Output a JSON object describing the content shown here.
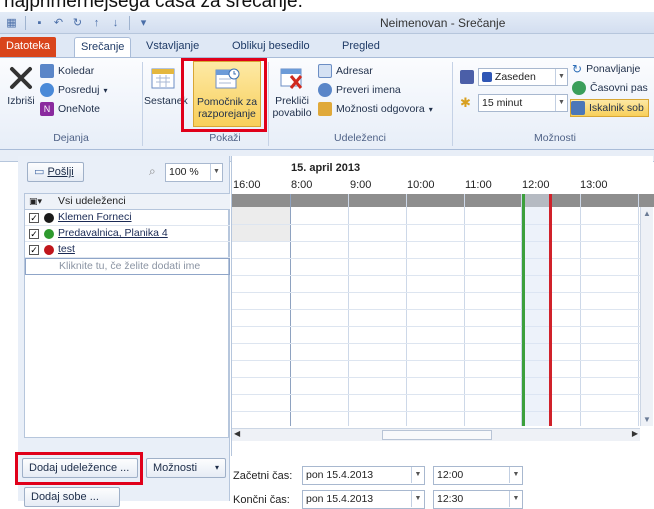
{
  "caption": "najprimernejšega časa za srečanje.",
  "window": {
    "title": "Neimenovan - Srečanje"
  },
  "tabs": [
    {
      "label": "Datoteka"
    },
    {
      "label": "Srečanje"
    },
    {
      "label": "Vstavljanje"
    },
    {
      "label": "Oblikuj besedilo"
    },
    {
      "label": "Pregled"
    }
  ],
  "ribbon": {
    "actions": {
      "delete": "Izbriši",
      "calendar": "Koledar",
      "forward": "Posreduj",
      "onenote": "OneNote",
      "group": "Dejanja"
    },
    "show": {
      "meeting": "Sestanek",
      "assistant_line1": "Pomočnik za",
      "assistant_line2": "razporejanje",
      "group": "Pokaži"
    },
    "attendees": {
      "cancel_line1": "Prekliči",
      "cancel_line2": "povabilo",
      "address_book": "Adresar",
      "check_names": "Preveri imena",
      "response_options": "Možnosti odgovora",
      "group": "Udeleženci"
    },
    "options": {
      "show_as": "Zaseden",
      "reminder": "15 minut",
      "recurrence": "Ponavljanje",
      "time_zones": "Časovni pas",
      "room_finder": "Iskalnik sob",
      "group": "Možnosti"
    }
  },
  "scheduler": {
    "send": "Pošlji",
    "zoom": "100 %",
    "date": "15. april 2013",
    "times": [
      "16:00",
      "8:00",
      "9:00",
      "10:00",
      "11:00",
      "12:00",
      "13:00"
    ],
    "attendees_header": "Vsi udeleženci",
    "attendees": [
      {
        "name": "Klemen Forneci",
        "status_color": "#1a1a1a"
      },
      {
        "name": "Predavalnica, Planika 4",
        "status_color": "#2e9a2e"
      },
      {
        "name": "test",
        "status_color": "#c0161c"
      }
    ],
    "add_hint": "Kliknite tu, če želite dodati ime",
    "add_attendees": "Dodaj udeležence ...",
    "options": "Možnosti",
    "add_rooms": "Dodaj sobe ...",
    "start_label": "Začetni čas:",
    "end_label": "Končni čas:",
    "start_date": "pon 15.4.2013",
    "start_time": "12:00",
    "end_date": "pon 15.4.2013",
    "end_time": "12:30"
  }
}
